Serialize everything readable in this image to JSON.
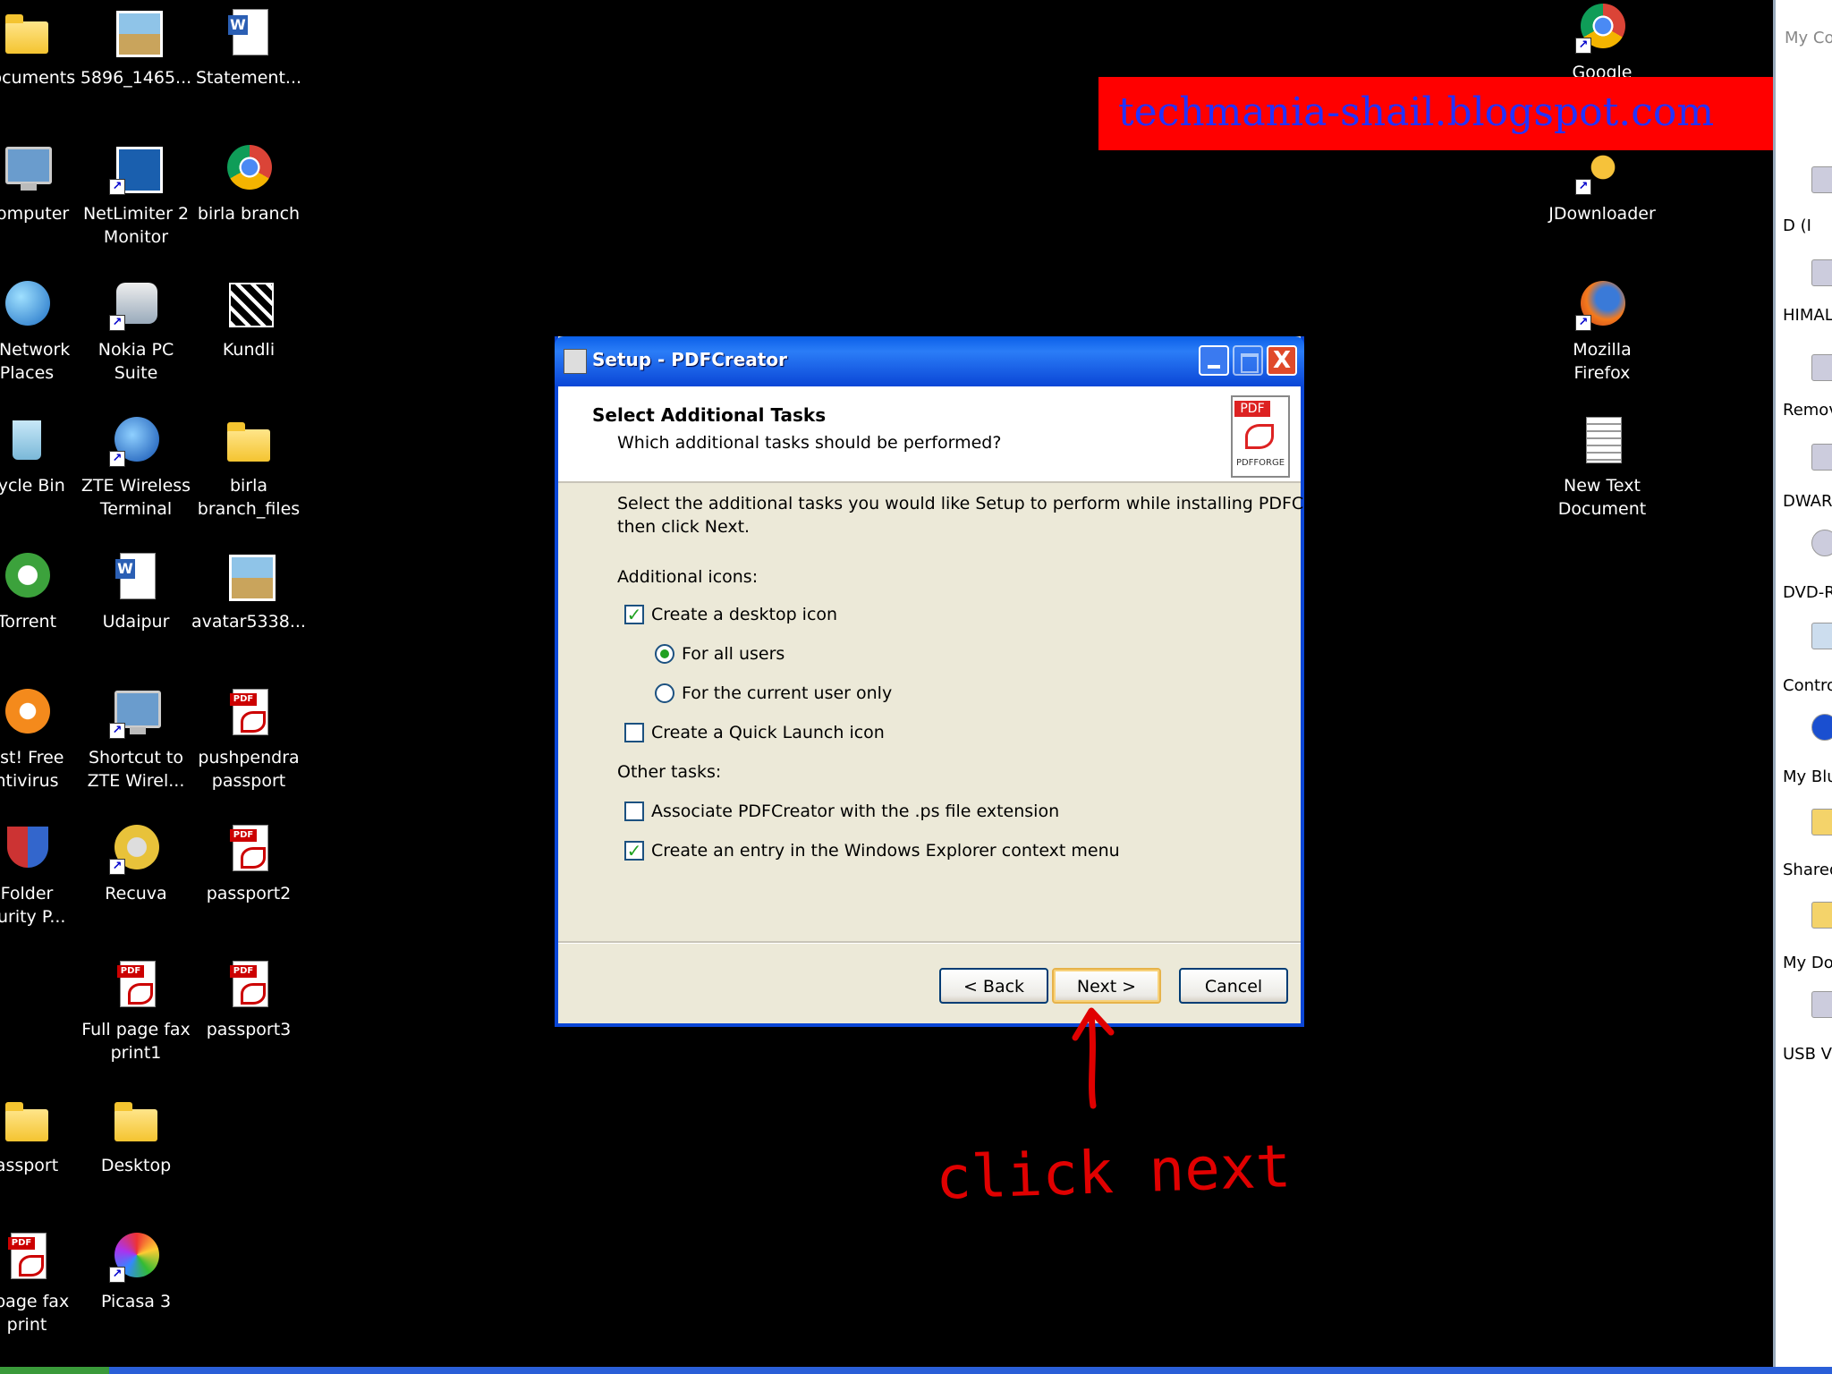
{
  "desktop": {
    "col1": [
      {
        "label": "Documents",
        "icon": "folder-icon"
      },
      {
        "label": "Computer",
        "icon": "computer-icon"
      },
      {
        "label": "y Network\nPlaces",
        "icon": "network-places-icon"
      },
      {
        "label": "cycle Bin",
        "icon": "recycle-bin-icon"
      },
      {
        "label": "Torrent",
        "icon": "utorrent-icon"
      },
      {
        "label": "ast! Free\nntivirus",
        "icon": "avast-icon"
      },
      {
        "label": "Folder\ncurity P...",
        "icon": "folder-security-icon"
      },
      {
        "label": "assport",
        "icon": "folder-icon"
      },
      {
        "label": "l page fax\nprint",
        "icon": "pdf-file-icon"
      }
    ],
    "col2": [
      {
        "label": "5896_1465...",
        "icon": "image-file-icon"
      },
      {
        "label": "NetLimiter 2\nMonitor",
        "icon": "netlimiter-icon"
      },
      {
        "label": "Nokia PC Suite",
        "icon": "nokia-pc-suite-icon"
      },
      {
        "label": "ZTE Wireless\nTerminal",
        "icon": "zte-wireless-icon"
      },
      {
        "label": "Udaipur",
        "icon": "word-document-icon"
      },
      {
        "label": "Shortcut to\nZTE Wirel...",
        "icon": "zte-shortcut-icon"
      },
      {
        "label": "Recuva",
        "icon": "recuva-icon"
      },
      {
        "label": "Full page fax\nprint1",
        "icon": "pdf-file-icon"
      },
      {
        "label": "Desktop",
        "icon": "zip-folder-icon"
      },
      {
        "label": "Picasa 3",
        "icon": "picasa-icon"
      }
    ],
    "col3": [
      {
        "label": "Statement...",
        "icon": "word-document-icon"
      },
      {
        "label": "birla branch",
        "icon": "chrome-icon"
      },
      {
        "label": "Kundli",
        "icon": "kundli-icon"
      },
      {
        "label": "birla\nbranch_files",
        "icon": "folder-icon"
      },
      {
        "label": "avatar5338...",
        "icon": "image-file-icon"
      },
      {
        "label": "pushpendra\npassport",
        "icon": "pdf-file-icon"
      },
      {
        "label": "passport2",
        "icon": "pdf-file-icon"
      },
      {
        "label": "passport3",
        "icon": "pdf-file-icon"
      }
    ],
    "right": [
      {
        "label": "JDownloader",
        "icon": "jdownloader-icon"
      },
      {
        "label": "Mozilla Firefox",
        "icon": "firefox-icon"
      },
      {
        "label": "New Text\nDocument",
        "icon": "text-document-icon"
      }
    ],
    "right_top_partial": "Google"
  },
  "watermark": "techmania-shail.blogspot.com",
  "explorer_panel": {
    "header": "My Co",
    "items": [
      "D (I",
      "HIMAL",
      "Remov",
      "DWARI",
      "DVD-R",
      "Contro",
      "My Blue",
      "Shared",
      "My Doc",
      "USB Vi"
    ]
  },
  "dialog": {
    "title": "Setup - PDFCreator",
    "header_title": "Select Additional Tasks",
    "header_subtitle": "Which additional tasks should be performed?",
    "logo_tag": "PDF",
    "logo_brand": "PDFFORGE",
    "intro_line1": "Select the additional tasks you would like Setup to perform while installing PDFCreator,",
    "intro_line2": "then click Next.",
    "group_icons": "Additional icons:",
    "opt_desktop_icon": "Create a desktop icon",
    "opt_all_users": "For all users",
    "opt_current_user": "For the current user only",
    "opt_quick_launch": "Create a Quick Launch icon",
    "group_other": "Other tasks:",
    "opt_associate_ps": "Associate PDFCreator with the .ps file extension",
    "opt_context_menu": "Create an entry in the Windows Explorer context menu",
    "back_label": "< Back",
    "next_label": "Next >",
    "cancel_label": "Cancel",
    "close_glyph": "X"
  },
  "annotation": "click next"
}
